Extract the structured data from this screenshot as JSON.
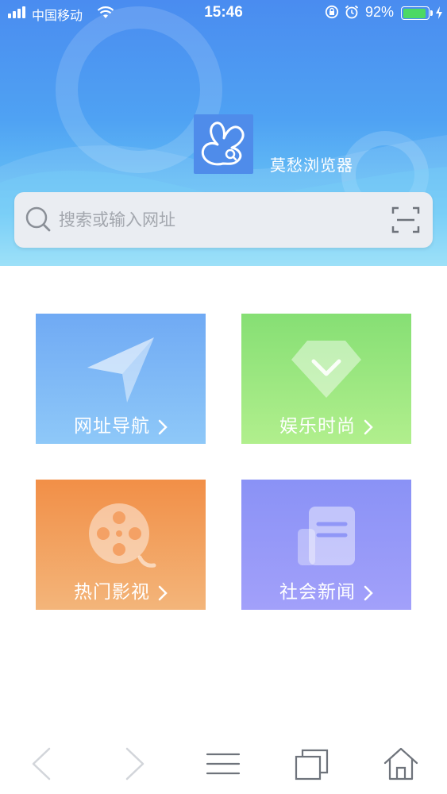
{
  "status_bar": {
    "carrier": "中国移动",
    "time": "15:46",
    "battery_percent": "92%",
    "battery_level": 0.92,
    "icons": [
      "signal-icon",
      "wifi-icon",
      "orientation-lock-icon",
      "alarm-icon",
      "battery-icon",
      "charging-icon"
    ]
  },
  "header": {
    "app_name": "莫愁浏览器",
    "logo_icon": "butterfly-logo-icon"
  },
  "search": {
    "placeholder": "搜索或输入网址",
    "value": "",
    "left_icon": "search-icon",
    "right_icon": "scan-icon"
  },
  "tiles": [
    {
      "label": "网址导航",
      "icon": "paper-plane-icon",
      "color": "#70aaf4"
    },
    {
      "label": "娱乐时尚",
      "icon": "diamond-icon",
      "color": "#86df74"
    },
    {
      "label": "热门影视",
      "icon": "film-reel-icon",
      "color": "#f28f47"
    },
    {
      "label": "社会新闻",
      "icon": "newspaper-icon",
      "color": "#8a92f6"
    }
  ],
  "toolbar": {
    "icons": [
      "back-icon",
      "forward-icon",
      "menu-icon",
      "tabs-icon",
      "home-icon"
    ]
  },
  "colors": {
    "header_top": "#4a8cf0",
    "header_bottom": "#a9e7f8",
    "search_bg": "#eaedf2",
    "battery_fill": "#4cd964"
  }
}
